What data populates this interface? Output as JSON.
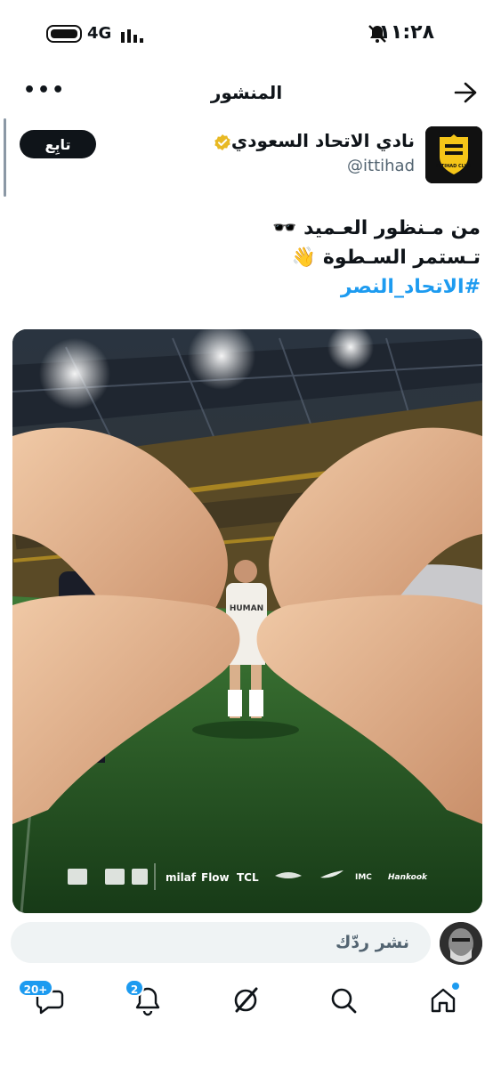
{
  "status_bar": {
    "time": "١١:٢٨",
    "network": "4G"
  },
  "header": {
    "title": "المنشور"
  },
  "post": {
    "author_name": "نادي الاتحاد السعودي",
    "author_handle": "@ittihad",
    "follow_label": "تابِع",
    "text_line1": "من مـنظور العـميد 🕶️",
    "text_line2": "تـستمر السـطوة 👋",
    "hashtag": "#الاتحاد_النصر",
    "logo_text": "ITTIHAD CLUB",
    "jersey_text": "HUMAN",
    "sponsors": [
      "milaf",
      "Flow",
      "TCL",
      "IMC",
      "Hankook"
    ]
  },
  "reply": {
    "placeholder": "نشر ردّك"
  },
  "bottom_nav": {
    "messages_badge": "20+",
    "notifications_badge": "2"
  },
  "colors": {
    "accent": "#1d9bf0",
    "ittihad_gold": "#f5c518",
    "text": "#0f1419",
    "muted": "#536471"
  }
}
